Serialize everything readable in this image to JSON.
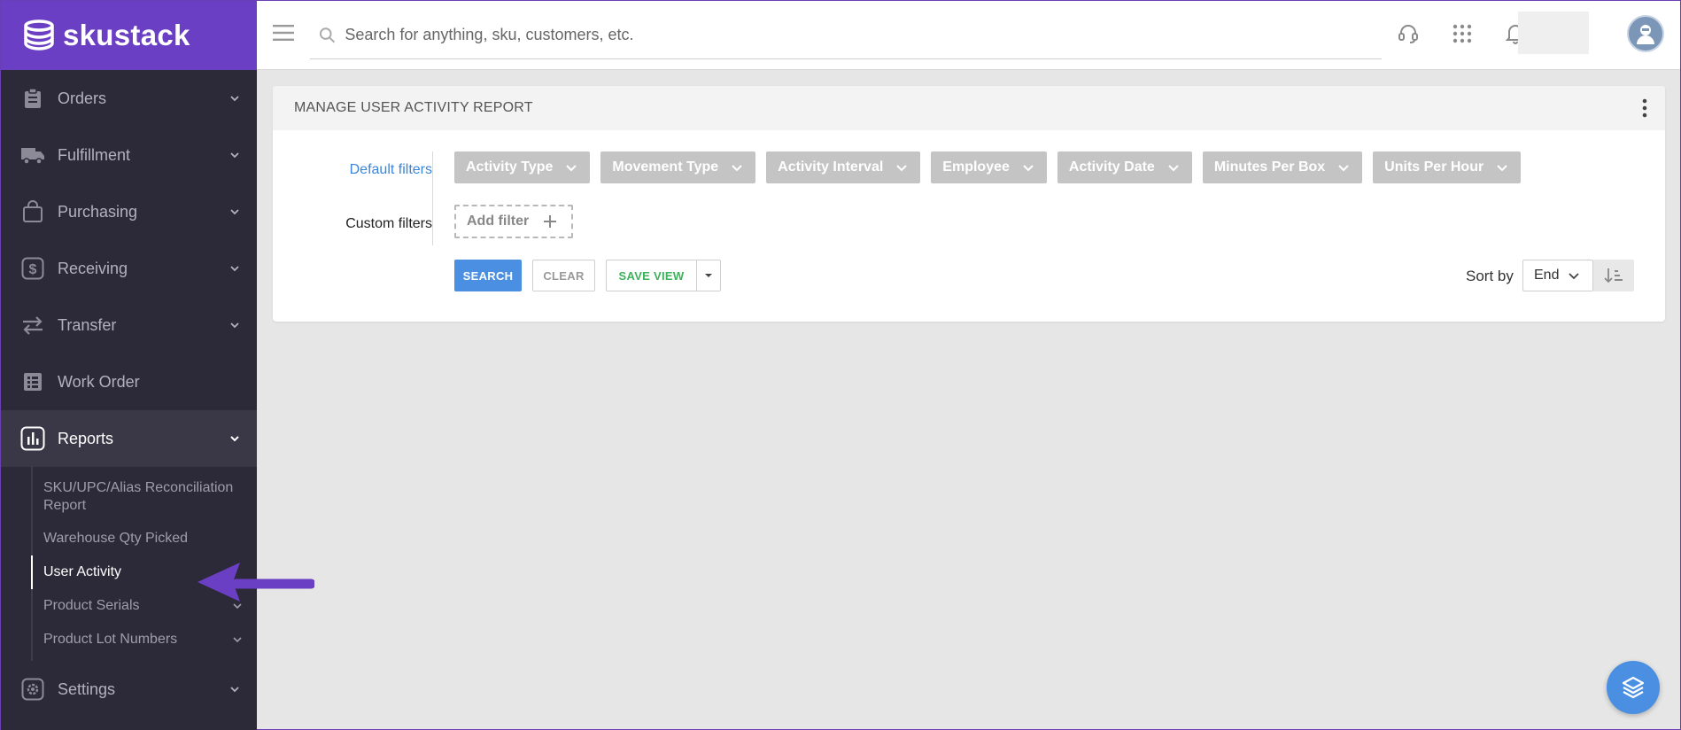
{
  "brand": {
    "name": "skustack"
  },
  "search": {
    "placeholder": "Search for anything, sku, customers, etc."
  },
  "sidebar": {
    "items": [
      {
        "label": "Orders",
        "icon": "clipboard-icon"
      },
      {
        "label": "Fulfillment",
        "icon": "truck-icon"
      },
      {
        "label": "Purchasing",
        "icon": "shopping-bag-icon"
      },
      {
        "label": "Receiving",
        "icon": "dollar-icon"
      },
      {
        "label": "Transfer",
        "icon": "transfer-arrows-icon"
      },
      {
        "label": "Work Order",
        "icon": "list-icon"
      },
      {
        "label": "Reports",
        "icon": "chart-icon"
      },
      {
        "label": "Settings",
        "icon": "gear-icon"
      }
    ],
    "reports_sub": [
      {
        "label": "SKU/UPC/Alias Reconciliation Report"
      },
      {
        "label": "Warehouse Qty Picked"
      },
      {
        "label": "User Activity"
      },
      {
        "label": "Product Serials"
      },
      {
        "label": "Product Lot Numbers"
      }
    ]
  },
  "card": {
    "title": "MANAGE USER ACTIVITY REPORT",
    "default_filters_label": "Default filters",
    "custom_filters_label": "Custom filters",
    "chips": [
      {
        "label": "Activity Type"
      },
      {
        "label": "Movement Type"
      },
      {
        "label": "Activity Interval"
      },
      {
        "label": "Employee"
      },
      {
        "label": "Activity Date"
      },
      {
        "label": "Minutes Per Box"
      },
      {
        "label": "Units Per Hour"
      }
    ],
    "add_filter_label": "Add filter",
    "buttons": {
      "search": "SEARCH",
      "clear": "CLEAR",
      "save_view": "SAVE VIEW"
    },
    "sort": {
      "label": "Sort by",
      "value": "End"
    }
  },
  "colors": {
    "brand": "#6a3fc4",
    "sidebar_bg": "#2c2a38",
    "primary": "#4a8fe2",
    "success": "#3cb35a",
    "chip_bg": "#c4c4c4",
    "annotation_arrow": "#6a3fc4"
  }
}
